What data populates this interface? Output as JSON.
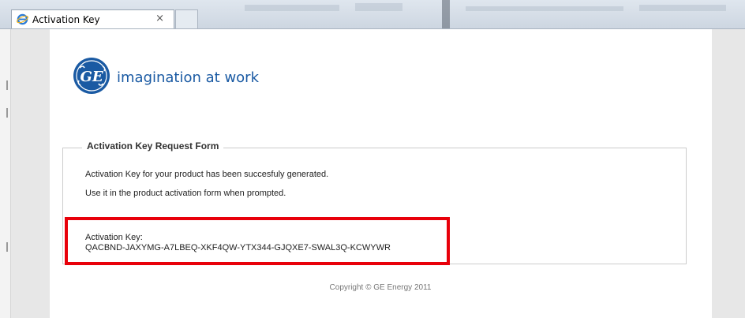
{
  "browser": {
    "tab_title": "Activation Key",
    "tab_close": "×"
  },
  "brand": {
    "tagline": "imagination at work",
    "logo_text": "GE",
    "color": "#1a5aa3"
  },
  "form": {
    "legend": "Activation Key Request Form",
    "message_line1": "Activation Key for your product has been succesfuly generated.",
    "message_line2": "Use it in the product activation form when prompted.",
    "key_label": "Activation Key:",
    "key_value": "QACBND-JAXYMG-A7LBEQ-XKF4QW-YTX344-GJQXE7-SWAL3Q-KCWYWR",
    "highlight_color": "#e8000a"
  },
  "footer": {
    "copyright": "Copyright © GE Energy 2011"
  }
}
